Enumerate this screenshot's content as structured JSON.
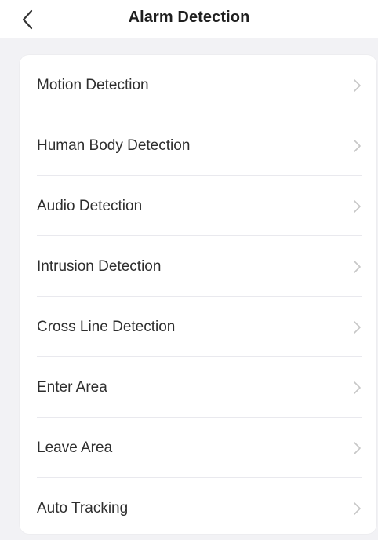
{
  "header": {
    "title": "Alarm Detection",
    "back_icon": "chevron-left-icon"
  },
  "menu": {
    "items": [
      {
        "label": "Motion Detection"
      },
      {
        "label": "Human Body Detection"
      },
      {
        "label": "Audio Detection"
      },
      {
        "label": "Intrusion Detection"
      },
      {
        "label": "Cross Line Detection"
      },
      {
        "label": "Enter Area"
      },
      {
        "label": "Leave Area"
      },
      {
        "label": "Auto Tracking"
      }
    ],
    "chevron_icon": "chevron-right-icon"
  },
  "colors": {
    "page_background": "#f2f2f5",
    "card_background": "#ffffff",
    "chevron": "#c7c7c7",
    "divider": "#e9e9ee"
  }
}
